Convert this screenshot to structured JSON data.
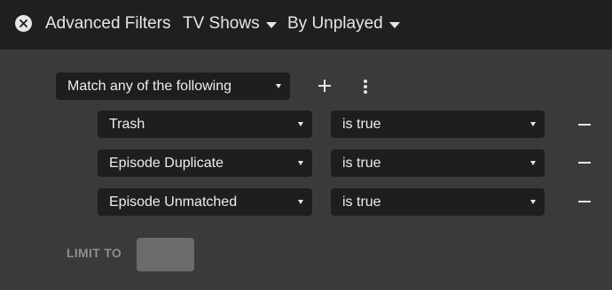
{
  "header": {
    "title": "Advanced Filters",
    "library_dropdown": "TV Shows",
    "view_dropdown": "By Unplayed",
    "close_icon": "close-icon",
    "colors": {
      "bar": "#1f1f1f",
      "text": "#e6e6e6"
    }
  },
  "filter": {
    "match_mode": "Match any of the following",
    "add_icon": "plus-icon",
    "more_icon": "more-vertical-icon",
    "rules": [
      {
        "field": "Trash",
        "condition": "is true"
      },
      {
        "field": "Episode Duplicate",
        "condition": "is true"
      },
      {
        "field": "Episode Unmatched",
        "condition": "is true"
      }
    ],
    "remove_icon": "minus-icon"
  },
  "limit": {
    "label": "LIMIT TO",
    "value": ""
  },
  "colors": {
    "background": "#3a3a3a",
    "select_bg": "#1e1e1e",
    "label_muted": "#8d8d8d",
    "input_bg": "#6b6b6b"
  }
}
